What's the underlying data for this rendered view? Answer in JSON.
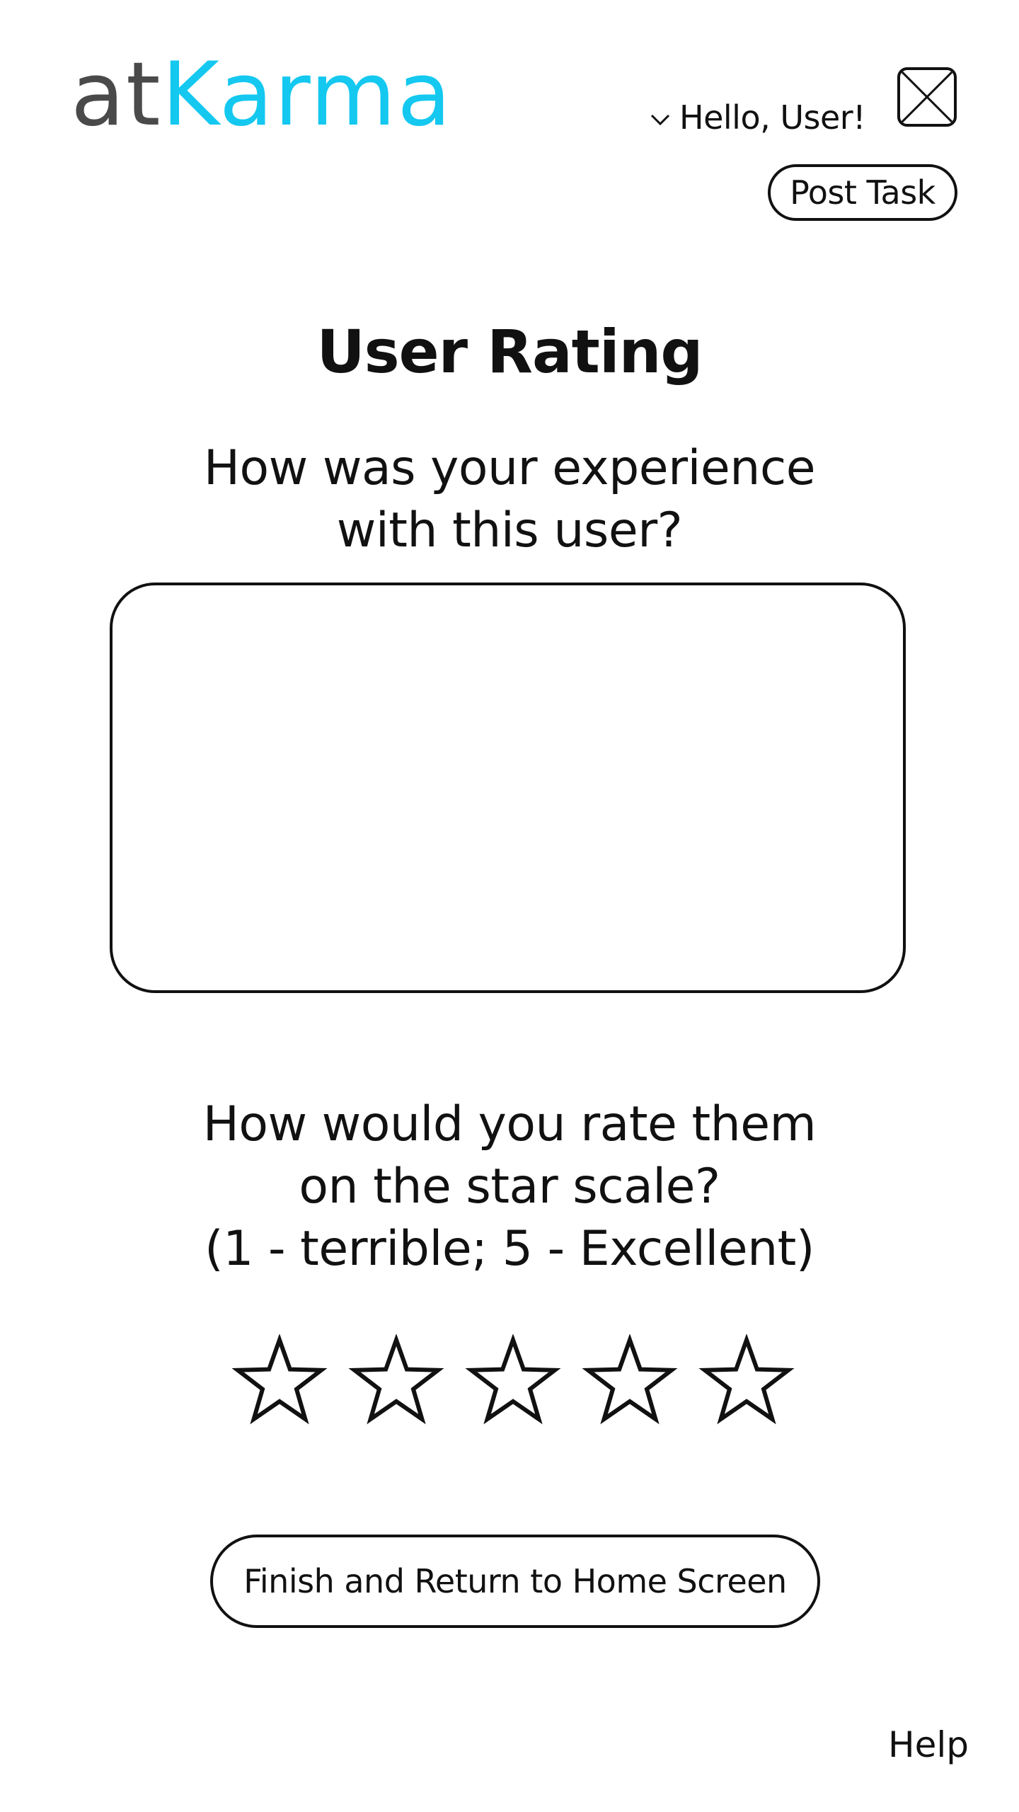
{
  "brand": {
    "logo_part1": "at",
    "logo_part2": "Karma",
    "color_dark": "#4a4a4a",
    "color_accent": "#14c8f0"
  },
  "header": {
    "greeting": "Hello, User!",
    "menu_icon": "chevron-down-icon",
    "avatar_icon": "image-placeholder-icon",
    "post_task_label": "Post Task"
  },
  "main": {
    "title": "User Rating",
    "experience_question": {
      "line1": "How was your experience",
      "line2": "with this user?"
    },
    "feedback_value": "",
    "star_question": {
      "line1": "How would you rate them",
      "line2": "on the star scale?",
      "line3": "(1 - terrible; 5 - Excellent)"
    },
    "rating": {
      "max": 5,
      "selected": 0,
      "icon": "star-outline-icon"
    },
    "finish_label": "Finish and Return to Home Screen"
  },
  "footer": {
    "help_label": "Help"
  }
}
